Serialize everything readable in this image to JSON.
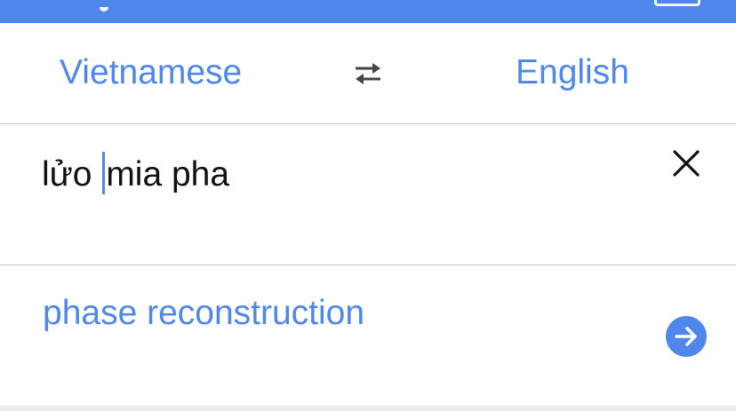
{
  "colors": {
    "accent": "#4f87ec",
    "text": "#111111",
    "divider": "#c4c4c4"
  },
  "language_bar": {
    "source_language": "Vietnamese",
    "target_language": "English",
    "swap_icon": "swap-arrows-icon"
  },
  "input": {
    "text_before_caret": "lửo ",
    "text_after_caret": "mia pha",
    "clear_icon": "close-icon"
  },
  "result": {
    "translation": "phase reconstruction",
    "go_icon": "arrow-right-icon"
  }
}
